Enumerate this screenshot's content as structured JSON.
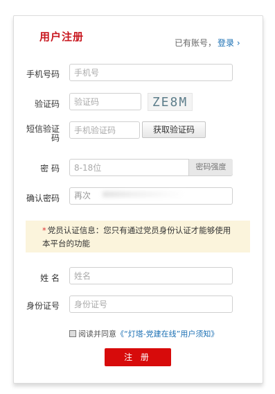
{
  "header": {
    "title": "用户注册",
    "login_prompt": "已有账号，",
    "login_link": "登录 ›"
  },
  "form": {
    "phone": {
      "label": "手机号码",
      "placeholder": "手机号"
    },
    "captcha": {
      "label": "验证码",
      "placeholder": "验证码",
      "image_text": "ZE8M"
    },
    "sms": {
      "label_line1": "短信验证",
      "label_line2": "码",
      "placeholder": "手机验证码",
      "button": "获取验证码"
    },
    "password": {
      "label": "密 码",
      "placeholder": "8-18位",
      "strength": "密码强度"
    },
    "confirm": {
      "label": "确认密码",
      "value": "再次"
    },
    "notice": {
      "star": "*",
      "text": "党员认证信息：您只有通过党员身份认证才能够使用本平台的功能"
    },
    "name": {
      "label": "姓 名",
      "placeholder": "姓名"
    },
    "idcard": {
      "label": "身份证号",
      "placeholder": "身份证号"
    },
    "agreement": {
      "prefix": "阅读并同意",
      "link": "《“灯塔-党建在线”用户须知》"
    },
    "submit": "注 册"
  }
}
